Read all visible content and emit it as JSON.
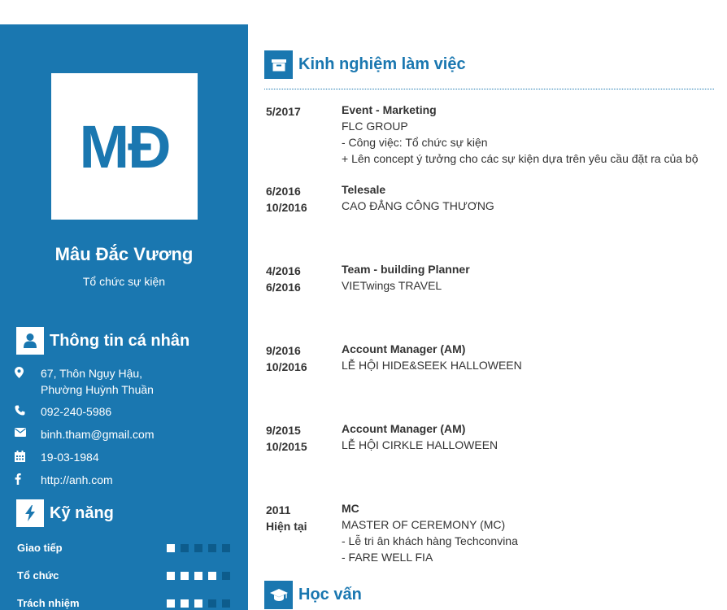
{
  "profile": {
    "initials": "MĐ",
    "name": "Mâu Đắc Vương",
    "role": "Tổ chức sự kiện"
  },
  "personal": {
    "heading": "Thông tin cá nhân",
    "address_line1": "67, Thôn Ngụy Hậu,",
    "address_line2": "Phường Huỳnh Thuần",
    "phone": "092-240-5986",
    "email": "binh.tham@gmail.com",
    "birthday": "19-03-1984",
    "website": "http://anh.com"
  },
  "skills": {
    "heading": "Kỹ năng",
    "items": [
      {
        "label": "Giao tiếp",
        "level": 1,
        "max": 5
      },
      {
        "label": "Tổ chức",
        "level": 4,
        "max": 5
      },
      {
        "label": "Trách nhiệm",
        "level": 3,
        "max": 5
      }
    ]
  },
  "experience": {
    "heading": "Kinh nghiệm làm việc",
    "jobs": [
      {
        "start": "5/2017",
        "end": "",
        "title": "Event - Marketing",
        "lines": [
          "FLC GROUP",
          "- Công việc: Tổ chức sự kiện",
          "+ Lên concept ý tưởng cho các sự kiện dựa trên yêu cầu đặt ra của bộ"
        ]
      },
      {
        "start": "6/2016",
        "end": "10/2016",
        "title": "Telesale",
        "lines": [
          "CAO ĐẲNG CÔNG THƯƠNG"
        ]
      },
      {
        "start": "4/2016",
        "end": "6/2016",
        "title": "Team - building Planner",
        "lines": [
          "VIETwings TRAVEL"
        ]
      },
      {
        "start": "9/2016",
        "end": "10/2016",
        "title": "Account Manager (AM)",
        "lines": [
          "LỄ HỘI HIDE&SEEK HALLOWEEN"
        ]
      },
      {
        "start": "9/2015",
        "end": "10/2015",
        "title": "Account Manager (AM)",
        "lines": [
          "LỄ HỘI CIRKLE HALLOWEEN"
        ]
      },
      {
        "start": "2011",
        "end": "Hiện tại",
        "title": "MC",
        "lines": [
          "MASTER OF CEREMONY (MC)",
          "- Lễ tri ân khách hàng Techconvina",
          "- FARE WELL FIA"
        ]
      }
    ]
  },
  "education": {
    "heading": "Học vấn"
  },
  "icons": {
    "user": "user-icon",
    "bolt": "bolt-icon",
    "briefcase": "briefcase-icon",
    "graduation": "graduation-cap-icon",
    "location": "map-marker-icon",
    "phone": "phone-icon",
    "email": "envelope-icon",
    "calendar": "calendar-icon",
    "facebook": "facebook-icon"
  },
  "colors": {
    "brand": "#1a77b0",
    "dot_off": "#0d5c8c"
  }
}
